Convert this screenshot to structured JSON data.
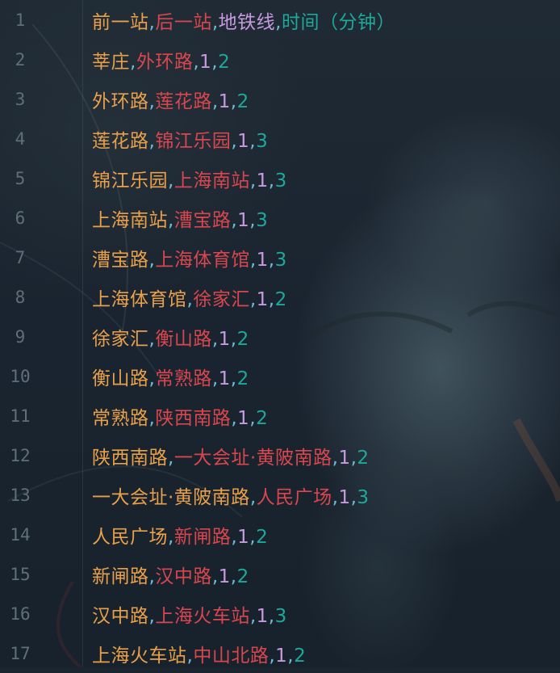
{
  "editor": {
    "colors": {
      "col1": "#e9a04a",
      "col2": "#d9464e",
      "col3": "#c79adf",
      "col4": "#1fa89a",
      "comma": "#6fbcd6",
      "line_number": "#5f6f7a"
    },
    "lines": [
      {
        "number": "1",
        "c1": "前一站",
        "c2": "后一站",
        "c3": "地铁线",
        "c4": "时间（分钟）"
      },
      {
        "number": "2",
        "c1": "莘庄",
        "c2": "外环路",
        "c3": "1",
        "c4": "2"
      },
      {
        "number": "3",
        "c1": "外环路",
        "c2": "莲花路",
        "c3": "1",
        "c4": "2"
      },
      {
        "number": "4",
        "c1": "莲花路",
        "c2": "锦江乐园",
        "c3": "1",
        "c4": "3"
      },
      {
        "number": "5",
        "c1": "锦江乐园",
        "c2": "上海南站",
        "c3": "1",
        "c4": "3"
      },
      {
        "number": "6",
        "c1": "上海南站",
        "c2": "漕宝路",
        "c3": "1",
        "c4": "3"
      },
      {
        "number": "7",
        "c1": "漕宝路",
        "c2": "上海体育馆",
        "c3": "1",
        "c4": "3"
      },
      {
        "number": "8",
        "c1": "上海体育馆",
        "c2": "徐家汇",
        "c3": "1",
        "c4": "2"
      },
      {
        "number": "9",
        "c1": "徐家汇",
        "c2": "衡山路",
        "c3": "1",
        "c4": "2"
      },
      {
        "number": "10",
        "c1": "衡山路",
        "c2": "常熟路",
        "c3": "1",
        "c4": "2"
      },
      {
        "number": "11",
        "c1": "常熟路",
        "c2": "陕西南路",
        "c3": "1",
        "c4": "2"
      },
      {
        "number": "12",
        "c1": "陕西南路",
        "c2": "一大会址·黄陂南路",
        "c3": "1",
        "c4": "2"
      },
      {
        "number": "13",
        "c1": "一大会址·黄陂南路",
        "c2": "人民广场",
        "c3": "1",
        "c4": "3"
      },
      {
        "number": "14",
        "c1": "人民广场",
        "c2": "新闸路",
        "c3": "1",
        "c4": "2"
      },
      {
        "number": "15",
        "c1": "新闸路",
        "c2": "汉中路",
        "c3": "1",
        "c4": "2"
      },
      {
        "number": "16",
        "c1": "汉中路",
        "c2": "上海火车站",
        "c3": "1",
        "c4": "3"
      },
      {
        "number": "17",
        "c1": "上海火车站",
        "c2": "中山北路",
        "c3": "1",
        "c4": "2"
      }
    ]
  }
}
